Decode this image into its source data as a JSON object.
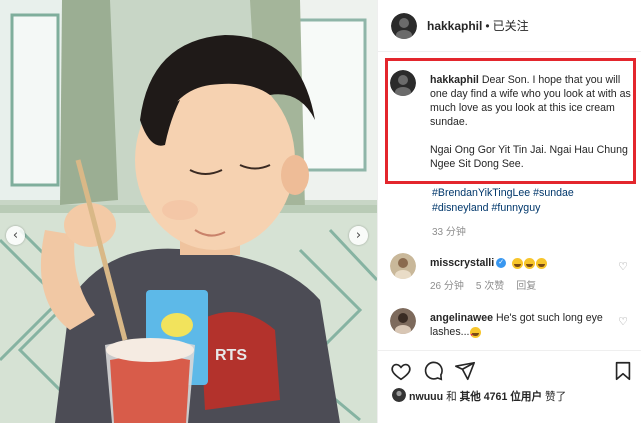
{
  "photo": {
    "prev_icon": "chevron-left-icon",
    "next_icon": "chevron-right-icon",
    "prev_glyph": "‹",
    "next_glyph": "›"
  },
  "header": {
    "username": "hakkaphil",
    "separator": "•",
    "follow_status": "已关注"
  },
  "caption": {
    "username": "hakkaphil",
    "text": "Dear Son. I hope that you will one day find a wife who you look at with as much love as you look at this ice cream sundae.",
    "text2": "Ngai Ong Gor Yit Tin Jai. Ngai Hau Chung Ngee Sit Dong See.",
    "hashtags": [
      "#BrendanYikTingLee",
      "#sundae",
      "#disneyland",
      "#funnyguy"
    ],
    "time": "33 分钟",
    "highlight_color": "#e3262d"
  },
  "comments": [
    {
      "username": "misscrystalli",
      "verified": true,
      "text": "",
      "emojis": [
        "grinning-face",
        "grinning-face",
        "grinning-face"
      ],
      "time": "26 分钟",
      "likes": "5 次赞",
      "reply": "回复"
    },
    {
      "username": "angelinawee",
      "verified": false,
      "text": "He's got such long eye lashes...",
      "emojis": [
        "smiling-face-with-heart-eyes"
      ],
      "time": "",
      "likes": "",
      "reply": ""
    }
  ],
  "actions": {
    "like_icon": "heart-icon",
    "comment_icon": "comment-icon",
    "share_icon": "share-icon",
    "save_icon": "bookmark-icon"
  },
  "likes": {
    "first_user": "nwuuu",
    "and": "和",
    "others": "其他",
    "count_text": "4761 位用户",
    "liked": "赞了"
  },
  "colors": {
    "link": "#00376b",
    "muted": "#8e8e8e",
    "verified": "#3897f0"
  }
}
